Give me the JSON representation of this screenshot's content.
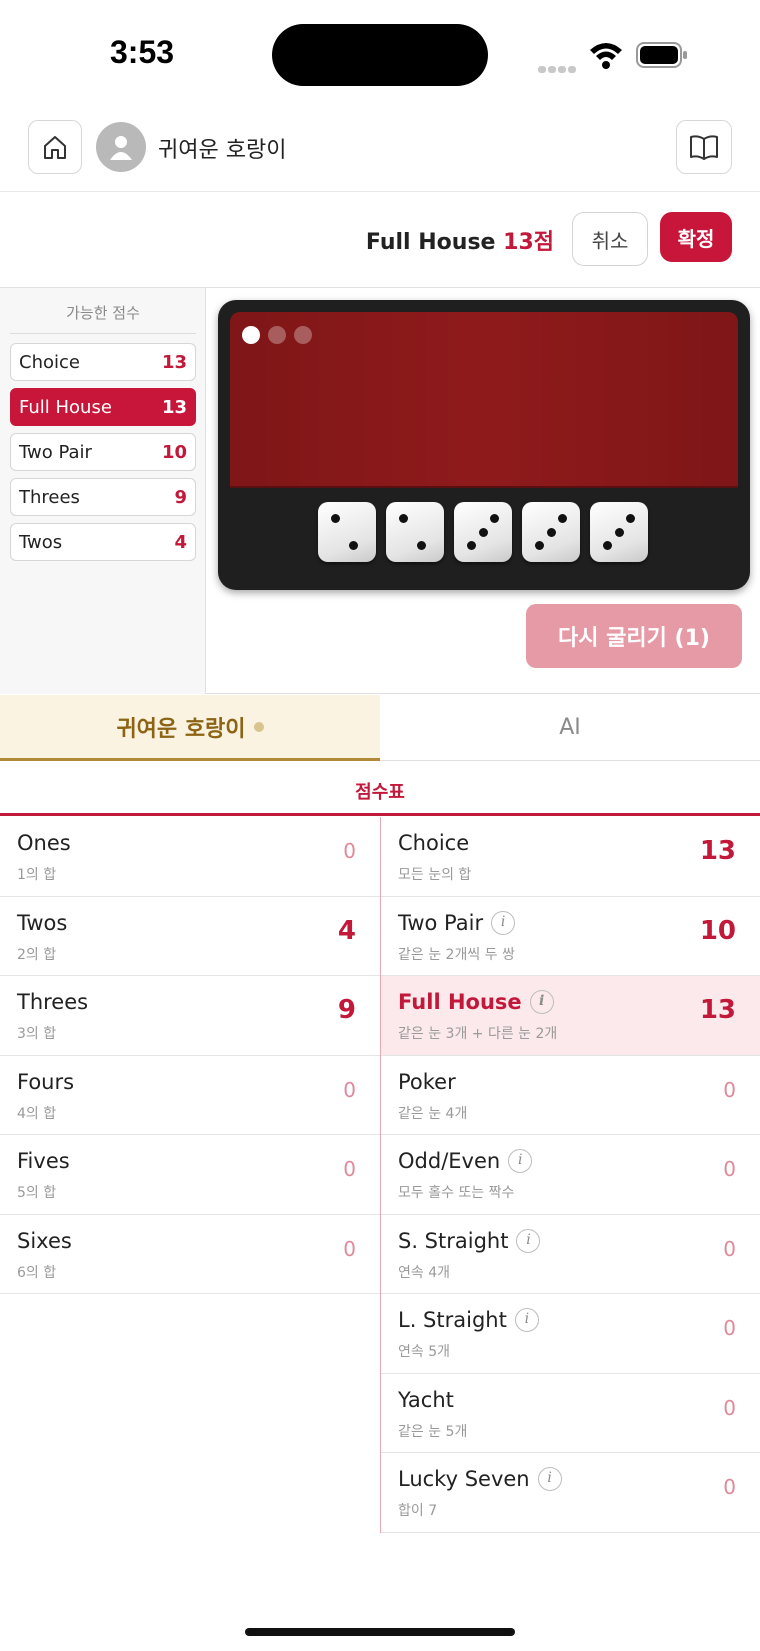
{
  "status_bar": {
    "time": "3:53"
  },
  "header": {
    "username": "귀여운 호랑이"
  },
  "action_bar": {
    "selected_category": "Full House",
    "selected_points": "13점",
    "cancel_label": "취소",
    "confirm_label": "확정"
  },
  "possible_scores": {
    "title": "가능한 점수",
    "items": [
      {
        "label": "Choice",
        "value": "13",
        "active": false
      },
      {
        "label": "Full House",
        "value": "13",
        "active": true
      },
      {
        "label": "Two Pair",
        "value": "10",
        "active": false
      },
      {
        "label": "Threes",
        "value": "9",
        "active": false
      },
      {
        "label": "Twos",
        "value": "4",
        "active": false
      }
    ]
  },
  "dice": {
    "values": [
      2,
      2,
      3,
      3,
      3
    ],
    "page_indicator": {
      "count": 3,
      "active": 0
    }
  },
  "reroll": {
    "label": "다시 굴리기 (1)"
  },
  "tabs": {
    "me": "귀여운 호랑이",
    "ai": "AI"
  },
  "scorecard": {
    "title": "점수표",
    "upper": [
      {
        "name": "Ones",
        "desc": "1의 합",
        "score": "0",
        "filled": false
      },
      {
        "name": "Twos",
        "desc": "2의 합",
        "score": "4",
        "filled": true
      },
      {
        "name": "Threes",
        "desc": "3의 합",
        "score": "9",
        "filled": true
      },
      {
        "name": "Fours",
        "desc": "4의 합",
        "score": "0",
        "filled": false
      },
      {
        "name": "Fives",
        "desc": "5의 합",
        "score": "0",
        "filled": false
      },
      {
        "name": "Sixes",
        "desc": "6의 합",
        "score": "0",
        "filled": false
      }
    ],
    "lower": [
      {
        "name": "Choice",
        "desc": "모든 눈의 합",
        "score": "13",
        "filled": true,
        "info": false
      },
      {
        "name": "Two Pair",
        "desc": "같은 눈 2개씩 두 쌍",
        "score": "10",
        "filled": true,
        "info": true
      },
      {
        "name": "Full House",
        "desc": "같은 눈 3개 + 다른 눈 2개",
        "score": "13",
        "filled": true,
        "info": true,
        "highlight": true
      },
      {
        "name": "Poker",
        "desc": "같은 눈 4개",
        "score": "0",
        "filled": false,
        "info": false
      },
      {
        "name": "Odd/Even",
        "desc": "모두 홀수 또는 짝수",
        "score": "0",
        "filled": false,
        "info": true
      },
      {
        "name": "S. Straight",
        "desc": "연속 4개",
        "score": "0",
        "filled": false,
        "info": true
      },
      {
        "name": "L. Straight",
        "desc": "연속 5개",
        "score": "0",
        "filled": false,
        "info": true
      },
      {
        "name": "Yacht",
        "desc": "같은 눈 5개",
        "score": "0",
        "filled": false,
        "info": false
      },
      {
        "name": "Lucky Seven",
        "desc": "합이 7",
        "score": "0",
        "filled": false,
        "info": true
      }
    ]
  },
  "info_glyph": "i",
  "colors": {
    "accent": "#c8163a",
    "tab_gold": "#8c6414",
    "felt": "#8f1a1c"
  }
}
